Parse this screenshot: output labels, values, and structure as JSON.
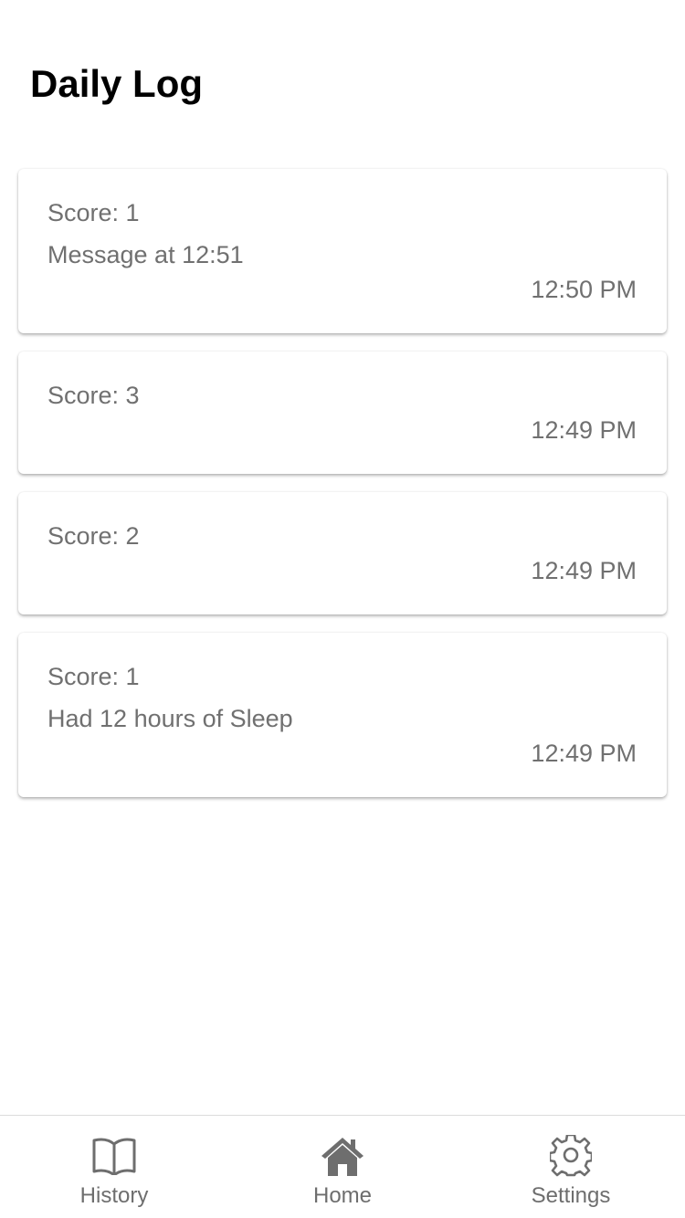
{
  "header": {
    "title": "Daily Log"
  },
  "entries": [
    {
      "score": "Score: 1",
      "message": "Message at 12:51",
      "time": "12:50 PM"
    },
    {
      "score": "Score: 3",
      "message": "",
      "time": "12:49 PM"
    },
    {
      "score": "Score: 2",
      "message": "",
      "time": "12:49 PM"
    },
    {
      "score": "Score: 1",
      "message": "Had 12 hours of Sleep",
      "time": "12:49 PM"
    }
  ],
  "tab_bar": {
    "items": [
      {
        "label": "History",
        "icon": "book-icon"
      },
      {
        "label": "Home",
        "icon": "home-icon"
      },
      {
        "label": "Settings",
        "icon": "gear-icon"
      }
    ]
  },
  "colors": {
    "text_primary": "#000000",
    "text_secondary": "#707070",
    "icon": "#6e6e6e",
    "divider": "#dcdcdc"
  }
}
